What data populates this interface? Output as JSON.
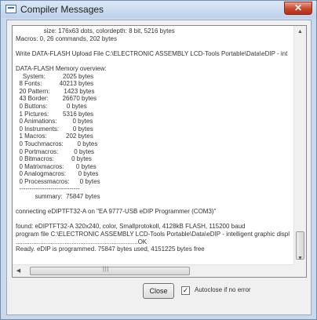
{
  "window": {
    "title": "Compiler Messages",
    "close_glyph": "✕"
  },
  "log_lines": [
    "                size: 176x63 dots, colordepth: 8 bit, 5216 bytes",
    "Macros: 0, 26 commands, 202 bytes",
    "",
    "Write DATA-FLASH Upload File C:\\ELECTRONIC ASSEMBLY LCD-Tools Portable\\Data\\eDIP - int",
    "",
    "DATA-FLASH Memory overview:",
    "    System:          2025 bytes",
    "  8 Fonts:          40213 bytes",
    "  20 Pattern:        1423 bytes",
    "  43 Border:        26670 bytes",
    "  0 Buttons:           0 bytes",
    "  1 Pictures:        5316 bytes",
    "  0 Animations:         0 bytes",
    "  0 Instruments:        0 bytes",
    "  1 Macros:           202 bytes",
    "  0 Touchmacros:        0 bytes",
    "  0 Portmacros:         0 bytes",
    "  0 Bitmacros:          0 bytes",
    "  0 Matrixmacros:       0 bytes",
    "  0 Analogmacros:       0 bytes",
    "  0 Processmacros:      0 bytes",
    "  -----------------------------",
    "           summary:  75847 bytes",
    "",
    "connecting eDIPTFT32-A on \"EA 9777-USB eDIP Programmer (COM3)\"",
    "",
    "found: eDIPTFT32-A 320x240, color, Smallprotokoll, 4128kB FLASH, 115200 baud",
    "program file C:\\ELECTRONIC ASSEMBLY LCD-Tools Portable\\Data\\eDIP - intelligent graphic displ",
    "......................................................................OK",
    "Ready. eDIP is programmed. 75847 bytes used, 4151225 bytes free"
  ],
  "scrollbars": {
    "up_arrow": "▲",
    "down_arrow": "▼",
    "left_arrow": "◀",
    "right_arrow": "▶",
    "grip": "|||"
  },
  "buttons": {
    "close_label": "Close"
  },
  "autoclose": {
    "label": "Autoclose if no error",
    "checked": true,
    "check_glyph": "✓"
  }
}
